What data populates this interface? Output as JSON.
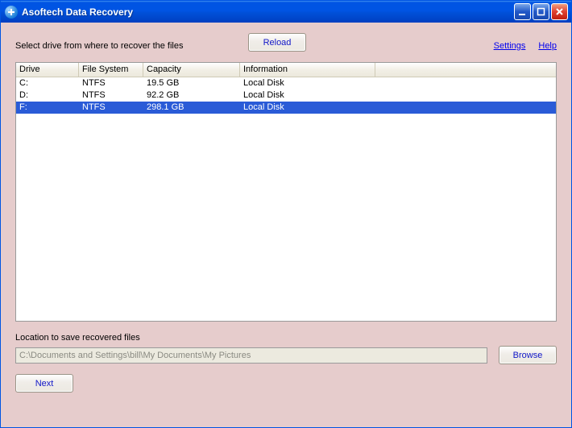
{
  "window": {
    "title": "Asoftech Data Recovery"
  },
  "top": {
    "instruction": "Select drive from where to recover the files",
    "reload_label": "Reload",
    "settings_label": "Settings",
    "help_label": "Help"
  },
  "grid": {
    "headers": {
      "drive": "Drive",
      "fs": "File System",
      "capacity": "Capacity",
      "info": "Information"
    },
    "rows": [
      {
        "drive": "C:",
        "fs": "NTFS",
        "capacity": "19.5 GB",
        "info": "Local Disk",
        "selected": false
      },
      {
        "drive": "D:",
        "fs": "NTFS",
        "capacity": "92.2 GB",
        "info": "Local Disk",
        "selected": false
      },
      {
        "drive": "F:",
        "fs": "NTFS",
        "capacity": "298.1 GB",
        "info": "Local Disk",
        "selected": true
      }
    ]
  },
  "save": {
    "label": "Location to save recovered files",
    "path": "C:\\Documents and Settings\\bill\\My Documents\\My Pictures",
    "browse_label": "Browse"
  },
  "nav": {
    "next_label": "Next"
  }
}
